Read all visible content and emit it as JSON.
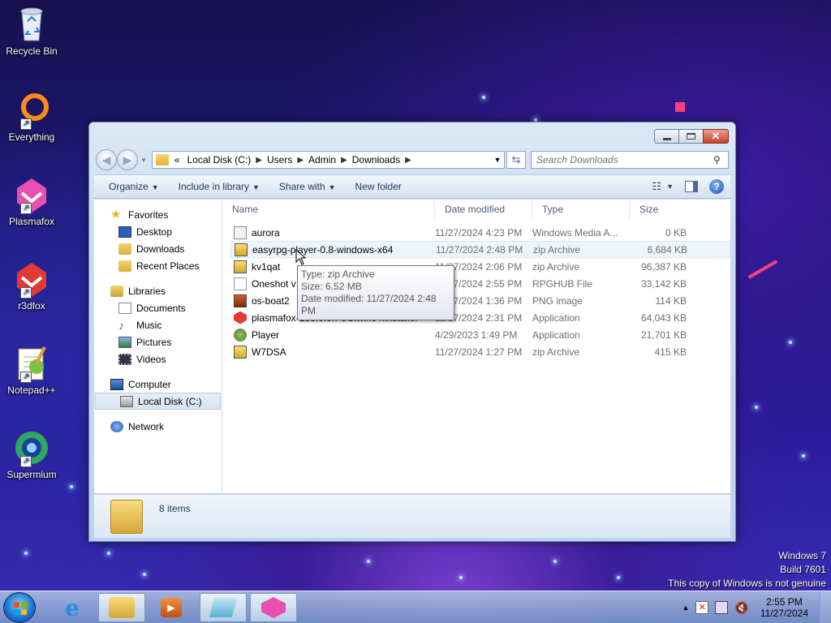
{
  "desktop": {
    "icons": [
      {
        "label": "Recycle Bin",
        "icon": "recycle-bin-icon"
      },
      {
        "label": "Everything",
        "icon": "everything-icon"
      },
      {
        "label": "Plasmafox",
        "icon": "plasmafox-icon"
      },
      {
        "label": "r3dfox",
        "icon": "r3dfox-icon"
      },
      {
        "label": "Notepad++",
        "icon": "notepadpp-icon"
      },
      {
        "label": "Supermium",
        "icon": "supermium-icon"
      }
    ],
    "watermark": {
      "line1": "Windows 7",
      "line2": "Build 7601",
      "line3": "This copy of Windows is not genuine"
    }
  },
  "window": {
    "address": {
      "chevron": "«",
      "segments": [
        "Local Disk (C:)",
        "Users",
        "Admin",
        "Downloads"
      ]
    },
    "search": {
      "placeholder": "Search Downloads"
    },
    "toolbar": {
      "organize": "Organize",
      "include_in_library": "Include in library",
      "share_with": "Share with",
      "new_folder": "New folder"
    },
    "nav": {
      "favorites": "Favorites",
      "desktop": "Desktop",
      "downloads": "Downloads",
      "recent_places": "Recent Places",
      "libraries": "Libraries",
      "documents": "Documents",
      "music": "Music",
      "pictures": "Pictures",
      "videos": "Videos",
      "computer": "Computer",
      "local_disk": "Local Disk (C:)",
      "network": "Network"
    },
    "columns": {
      "name": "Name",
      "date": "Date modified",
      "type": "Type",
      "size": "Size"
    },
    "files": [
      {
        "name": "aurora",
        "date": "11/27/2024 4:23 PM",
        "type": "Windows Media A...",
        "size": "0 KB"
      },
      {
        "name": "easyrpg-player-0.8-windows-x64",
        "date": "11/27/2024 2:48 PM",
        "type": "zip Archive",
        "size": "6,684 KB"
      },
      {
        "name": "kv1qat",
        "date": "11/27/2024 2:06 PM",
        "type": "zip Archive",
        "size": "96,387 KB"
      },
      {
        "name": "Oneshot v",
        "date": "11/27/2024 2:55 PM",
        "type": "RPGHUB File",
        "size": "33,142 KB"
      },
      {
        "name": "os-boat2",
        "date": "11/27/2024 1:36 PM",
        "type": "PNG image",
        "size": "114 KB"
      },
      {
        "name": "plasmafox-133.0.en-US.win64.installer",
        "date": "11/27/2024 2:31 PM",
        "type": "Application",
        "size": "64,043 KB"
      },
      {
        "name": "Player",
        "date": "4/29/2023 1:49 PM",
        "type": "Application",
        "size": "21,701 KB"
      },
      {
        "name": "W7DSA",
        "date": "11/27/2024 1:27 PM",
        "type": "zip Archive",
        "size": "415 KB"
      }
    ],
    "tooltip": {
      "type": "Type: zip Archive",
      "size": "Size: 6.52 MB",
      "modified": "Date modified: 11/27/2024 2:48 PM"
    },
    "details": {
      "count": "8 items"
    }
  },
  "taskbar": {
    "clock": {
      "time": "2:55 PM",
      "date": "11/27/2024"
    }
  },
  "colors": {
    "accent": "#1e395b",
    "close_button": "#c6412b",
    "selection": "#d7e3f1"
  }
}
